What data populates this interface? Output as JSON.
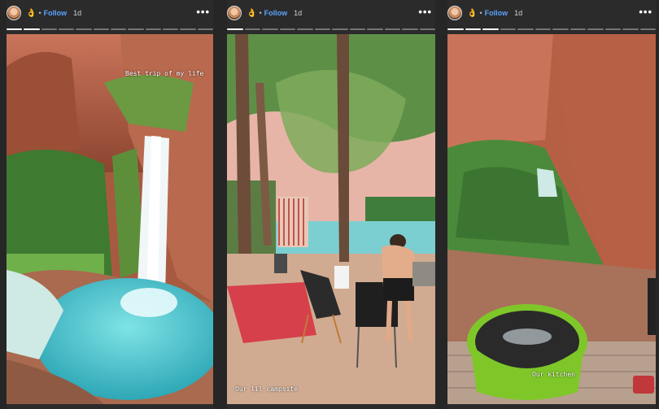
{
  "stories": [
    {
      "follow_label": "Follow",
      "age": "1d",
      "emoji": "👌",
      "more": "•••",
      "caption": "Best trip of my life"
    },
    {
      "follow_label": "Follow",
      "age": "1d",
      "emoji": "👌",
      "more": "•••",
      "caption": "Our lil campsite"
    },
    {
      "follow_label": "Follow",
      "age": "1d",
      "emoji": "👌",
      "more": "•••",
      "caption": "Our kitchen"
    }
  ],
  "colors": {
    "background": "#262626",
    "follow": "#5aa2ff",
    "water": "#4fc3c9",
    "rock": "#b8644a",
    "foliage": "#4e8a3b"
  }
}
